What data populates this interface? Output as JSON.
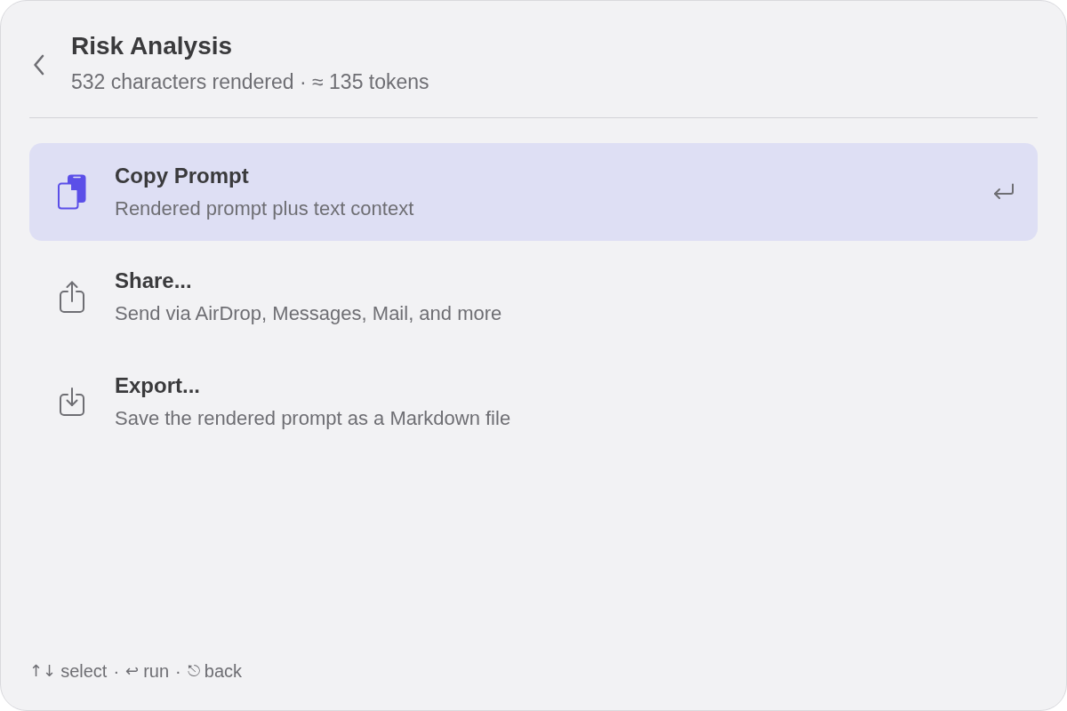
{
  "header": {
    "title": "Risk Analysis",
    "subtitle": "532 characters rendered · ≈ 135 tokens"
  },
  "actions": [
    {
      "kind": "copy",
      "title": "Copy Prompt",
      "description": "Rendered prompt plus text context",
      "selected": true
    },
    {
      "kind": "share",
      "title": "Share...",
      "description": "Send via AirDrop, Messages, Mail, and more",
      "selected": false
    },
    {
      "kind": "export",
      "title": "Export...",
      "description": "Save the rendered prompt as a Markdown file",
      "selected": false
    }
  ],
  "footer": {
    "hints": [
      {
        "keys": "↑↓",
        "label": "select"
      },
      {
        "keys": "↩",
        "label": "run"
      },
      {
        "keys": "⎋",
        "label": "back"
      }
    ],
    "separator": "·"
  }
}
